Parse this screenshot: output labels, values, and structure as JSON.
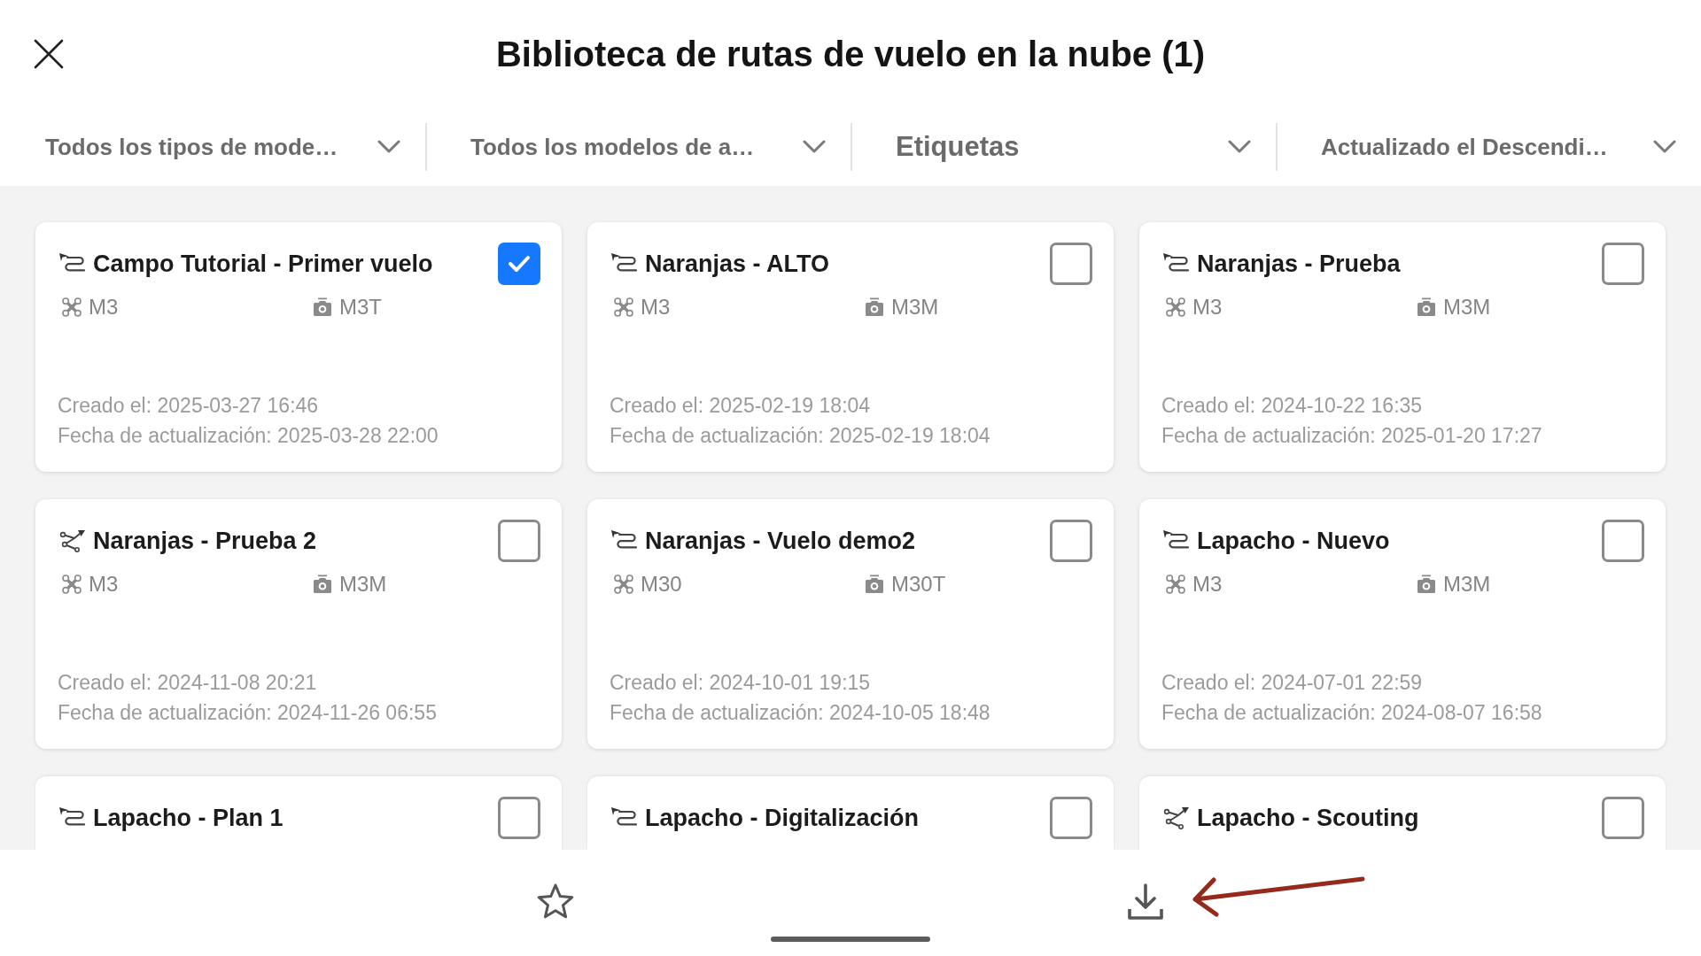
{
  "window": {
    "title": "Biblioteca de rutas de vuelo en la nube (1)"
  },
  "filters": [
    {
      "value": "Todos los tipos de mode…"
    },
    {
      "value": "Todos los modelos de a…"
    },
    {
      "placeholder": "Etiquetas"
    },
    {
      "value": "Actualizado el Descendi…"
    }
  ],
  "routes": [
    {
      "kind": "area",
      "name": "Campo Tutorial - Primer vuelo",
      "checked": true,
      "aircraft": "M3",
      "camera": "M3T",
      "created": "Creado el: 2025-03-27 16:46",
      "updated": "Fecha de actualización: 2025-03-28 22:00"
    },
    {
      "kind": "area",
      "name": "Naranjas - ALTO",
      "checked": false,
      "aircraft": "M3",
      "camera": "M3M",
      "created": "Creado el: 2025-02-19 18:04",
      "updated": "Fecha de actualización: 2025-02-19 18:04"
    },
    {
      "kind": "area",
      "name": "Naranjas - Prueba",
      "checked": false,
      "aircraft": "M3",
      "camera": "M3M",
      "created": "Creado el: 2024-10-22 16:35",
      "updated": "Fecha de actualización: 2025-01-20 17:27"
    },
    {
      "kind": "waypoint",
      "name": "Naranjas - Prueba 2",
      "checked": false,
      "aircraft": "M3",
      "camera": "M3M",
      "created": "Creado el: 2024-11-08 20:21",
      "updated": "Fecha de actualización: 2024-11-26 06:55"
    },
    {
      "kind": "area",
      "name": "Naranjas - Vuelo demo2",
      "checked": false,
      "aircraft": "M30",
      "camera": "M30T",
      "created": "Creado el: 2024-10-01 19:15",
      "updated": "Fecha de actualización: 2024-10-05 18:48"
    },
    {
      "kind": "area",
      "name": "Lapacho - Nuevo",
      "checked": false,
      "aircraft": "M3",
      "camera": "M3M",
      "created": "Creado el: 2024-07-01 22:59",
      "updated": "Fecha de actualización: 2024-08-07 16:58"
    },
    {
      "kind": "area",
      "name": "Lapacho - Plan 1",
      "checked": false
    },
    {
      "kind": "area",
      "name": "Lapacho - Digitalización",
      "checked": false
    },
    {
      "kind": "waypoint",
      "name": "Lapacho - Scouting",
      "checked": false
    }
  ]
}
